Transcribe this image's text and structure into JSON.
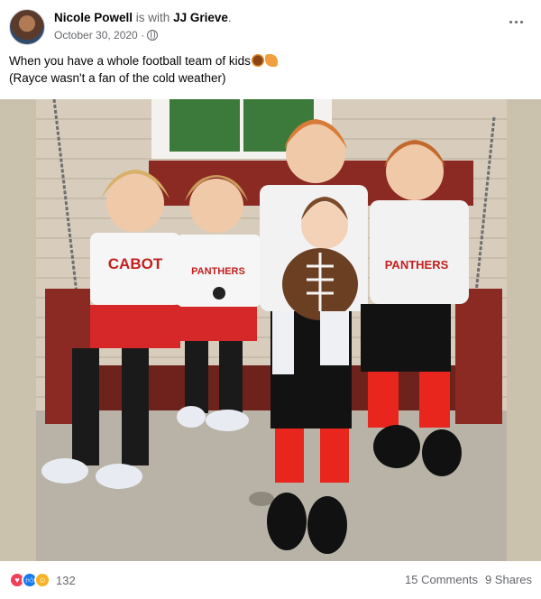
{
  "post": {
    "author": "Nicole Powell",
    "with_text": "is with",
    "tagged": "JJ Grieve",
    "tagged_suffix": ".",
    "date": "October 30, 2020 ·",
    "caption_line1": "When you have a whole football team of kids",
    "caption_line2": "(Rayce wasn't a fan of the cold weather)",
    "photo_texts": {
      "jersey_left": "CABOT",
      "jersey_middle": "PANTHERS",
      "jersey_right": "PANTHERS"
    },
    "reactions": {
      "count": "132",
      "icons": [
        "love-icon",
        "like-icon",
        "care-icon"
      ]
    },
    "comments": "15 Comments",
    "shares": "9 Shares"
  },
  "colors": {
    "text_primary": "#050505",
    "text_secondary": "#65676b",
    "love": "#f33e58",
    "like": "#1877f2",
    "care": "#f7b125",
    "cheer_red": "#d62828",
    "swing_wood": "#8a2a22"
  }
}
